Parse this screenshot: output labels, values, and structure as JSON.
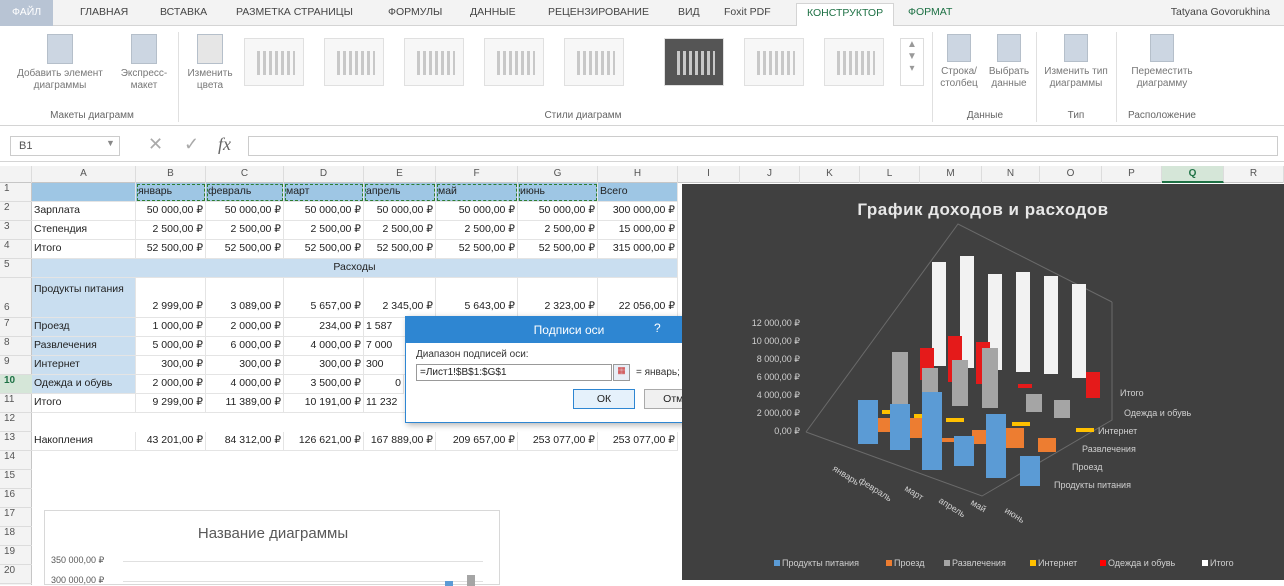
{
  "tabs": [
    {
      "label": "ФАЙЛ"
    },
    {
      "label": "ГЛАВНАЯ"
    },
    {
      "label": "ВСТАВКА"
    },
    {
      "label": "РАЗМЕТКА СТРАНИЦЫ"
    },
    {
      "label": "ФОРМУЛЫ"
    },
    {
      "label": "ДАННЫЕ"
    },
    {
      "label": "РЕЦЕНЗИРОВАНИЕ"
    },
    {
      "label": "ВИД"
    },
    {
      "label": "Foxit PDF"
    },
    {
      "label": "КОНСТРУКТОР"
    },
    {
      "label": "ФОРМАТ"
    }
  ],
  "user": "Tatyana Govorukhina",
  "ribbon": {
    "add_element": "Добавить элемент диаграммы",
    "express_layout": "Экспресс-макет",
    "change_colors": "Изменить цвета",
    "group_layouts": "Макеты диаграмм",
    "group_styles": "Стили диаграмм",
    "row_col": "Строка/ столбец",
    "select_data": "Выбрать данные",
    "group_data": "Данные",
    "change_type": "Изменить тип диаграммы",
    "group_type": "Тип",
    "move_chart": "Переместить диаграмму",
    "group_location": "Расположение"
  },
  "formula_bar": {
    "name_box": "B1",
    "formula": ""
  },
  "columns": [
    "A",
    "B",
    "C",
    "D",
    "E",
    "F",
    "G",
    "H",
    "I",
    "J",
    "K",
    "L",
    "M",
    "N",
    "O",
    "P",
    "Q",
    "R"
  ],
  "rows": [
    "1",
    "2",
    "3",
    "4",
    "5",
    "6",
    "7",
    "8",
    "9",
    "10",
    "11",
    "12",
    "13",
    "14",
    "15",
    "16",
    "17",
    "18",
    "19",
    "20"
  ],
  "sheet": {
    "header": [
      "",
      "январь",
      "февраль",
      "март",
      "апрель",
      "май",
      "июнь",
      "Всего"
    ],
    "r2": [
      "Зарплата",
      "50 000,00 ₽",
      "50 000,00 ₽",
      "50 000,00 ₽",
      "50 000,00 ₽",
      "50 000,00 ₽",
      "50 000,00 ₽",
      "300 000,00 ₽"
    ],
    "r3": [
      "Степендия",
      "2 500,00 ₽",
      "2 500,00 ₽",
      "2 500,00 ₽",
      "2 500,00 ₽",
      "2 500,00 ₽",
      "2 500,00 ₽",
      "15 000,00 ₽"
    ],
    "r4": [
      "Итого",
      "52 500,00 ₽",
      "52 500,00 ₽",
      "52 500,00 ₽",
      "52 500,00 ₽",
      "52 500,00 ₽",
      "52 500,00 ₽",
      "315 000,00 ₽"
    ],
    "r5": "Расходы",
    "r6": [
      "Продукты питания",
      "2 999,00 ₽",
      "3 089,00 ₽",
      "5 657,00 ₽",
      "2 345,00 ₽",
      "5 643,00 ₽",
      "2 323,00 ₽",
      "22 056,00 ₽"
    ],
    "r7": [
      "Проезд",
      "1 000,00 ₽",
      "2 000,00 ₽",
      "234,00 ₽",
      "1 587"
    ],
    "r8": [
      "Развлечения",
      "5 000,00 ₽",
      "6 000,00 ₽",
      "4 000,00 ₽",
      "7 000"
    ],
    "r9": [
      "Интернет",
      "300,00 ₽",
      "300,00 ₽",
      "300,00 ₽",
      "300"
    ],
    "r10": [
      "Одежда и обувь",
      "2 000,00 ₽",
      "4 000,00 ₽",
      "3 500,00 ₽",
      "0"
    ],
    "r11": [
      "Итого",
      "9 299,00 ₽",
      "11 389,00 ₽",
      "10 191,00 ₽",
      "11 232"
    ],
    "r13": [
      "Накопления",
      "43 201,00 ₽",
      "84 312,00 ₽",
      "126 621,00 ₽",
      "167 889,00 ₽",
      "209 657,00 ₽",
      "253 077,00 ₽",
      "253 077,00 ₽"
    ]
  },
  "dialog": {
    "title": "Подписи оси",
    "help": "?",
    "close": "✕",
    "label": "Диапазон подписей оси:",
    "value": "=Лист1!$B$1:$G$1",
    "preview": "= январь; феврал...",
    "ok": "ОК",
    "cancel": "Отмена"
  },
  "chart": {
    "title": "График доходов и расходов",
    "y_ticks": [
      "12 000,00 ₽",
      "10 000,00 ₽",
      "8 000,00 ₽",
      "6 000,00 ₽",
      "4 000,00 ₽",
      "2 000,00 ₽",
      "0,00 ₽"
    ],
    "x_labels": [
      "январь",
      "февраль",
      "март",
      "апрель",
      "май",
      "июнь"
    ],
    "depth_labels": [
      "Итого",
      "Одежда и обувь",
      "Интернет",
      "Развлечения",
      "Проезд",
      "Продукты питания"
    ],
    "legend": [
      {
        "name": "Продукты питания",
        "color": "#5b9bd5"
      },
      {
        "name": "Проезд",
        "color": "#ed7d31"
      },
      {
        "name": "Развлечения",
        "color": "#a5a5a5"
      },
      {
        "name": "Интернет",
        "color": "#ffc000"
      },
      {
        "name": "Одежда и обувь",
        "color": "#ff0000"
      },
      {
        "name": "Итого",
        "color": "#ffffff"
      }
    ]
  },
  "chart2": {
    "title": "Название диаграммы",
    "y_ticks": [
      "350 000,00 ₽",
      "300 000,00 ₽"
    ]
  }
}
